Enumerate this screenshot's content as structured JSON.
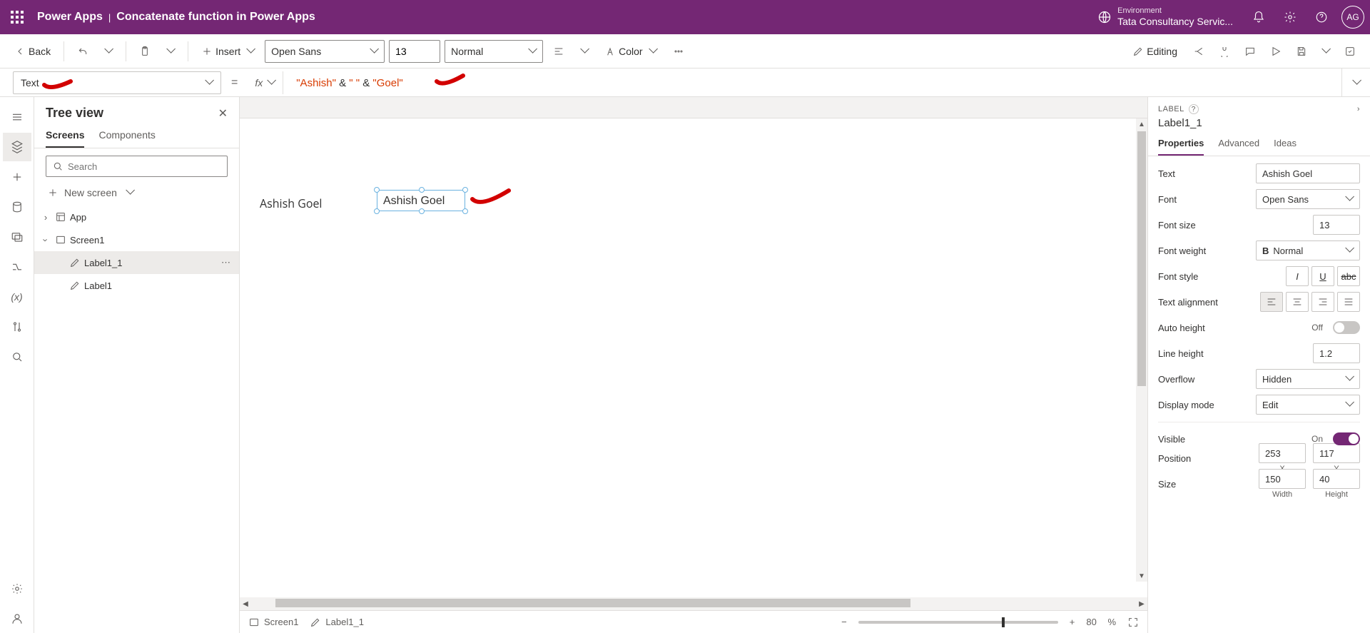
{
  "header": {
    "product": "Power Apps",
    "app_name": "Concatenate function in Power Apps",
    "env_label": "Environment",
    "env_name": "Tata Consultancy Servic...",
    "avatar": "AG"
  },
  "toolbar": {
    "back": "Back",
    "insert": "Insert",
    "font_family": "Open Sans",
    "font_size": "13",
    "font_weight": "Normal",
    "color": "Color",
    "editing": "Editing"
  },
  "formula": {
    "property": "Text",
    "parts": {
      "s1": "\"Ashish\"",
      "amp1": " & ",
      "s2": "\" \"",
      "amp2": " & ",
      "s3": "\"Goel\""
    }
  },
  "tree": {
    "title": "Tree view",
    "tab_screens": "Screens",
    "tab_components": "Components",
    "search_placeholder": "Search",
    "new_screen": "New screen",
    "items": {
      "app": "App",
      "screen1": "Screen1",
      "label1_1": "Label1_1",
      "label1": "Label1"
    }
  },
  "canvas": {
    "label1_text": "Ashish Goel",
    "label1_1_text": "Ashish Goel"
  },
  "status": {
    "screen": "Screen1",
    "control": "Label1_1",
    "zoom_value": "80",
    "zoom_unit": "%"
  },
  "props": {
    "type": "LABEL",
    "name": "Label1_1",
    "tab_properties": "Properties",
    "tab_advanced": "Advanced",
    "tab_ideas": "Ideas",
    "rows": {
      "text_label": "Text",
      "text_value": "Ashish Goel",
      "font_label": "Font",
      "font_value": "Open Sans",
      "fontsize_label": "Font size",
      "fontsize_value": "13",
      "fontweight_label": "Font weight",
      "fontweight_prefix": "B",
      "fontweight_value": "Normal",
      "fontstyle_label": "Font style",
      "align_label": "Text alignment",
      "autoheight_label": "Auto height",
      "autoheight_value": "Off",
      "lineheight_label": "Line height",
      "lineheight_value": "1.2",
      "overflow_label": "Overflow",
      "overflow_value": "Hidden",
      "displaymode_label": "Display mode",
      "displaymode_value": "Edit",
      "visible_label": "Visible",
      "visible_value": "On",
      "position_label": "Position",
      "x_value": "253",
      "y_value": "117",
      "x_label": "X",
      "y_label": "Y",
      "size_label": "Size",
      "w_value": "150",
      "h_value": "40",
      "w_label": "Width",
      "h_label": "Height"
    }
  }
}
